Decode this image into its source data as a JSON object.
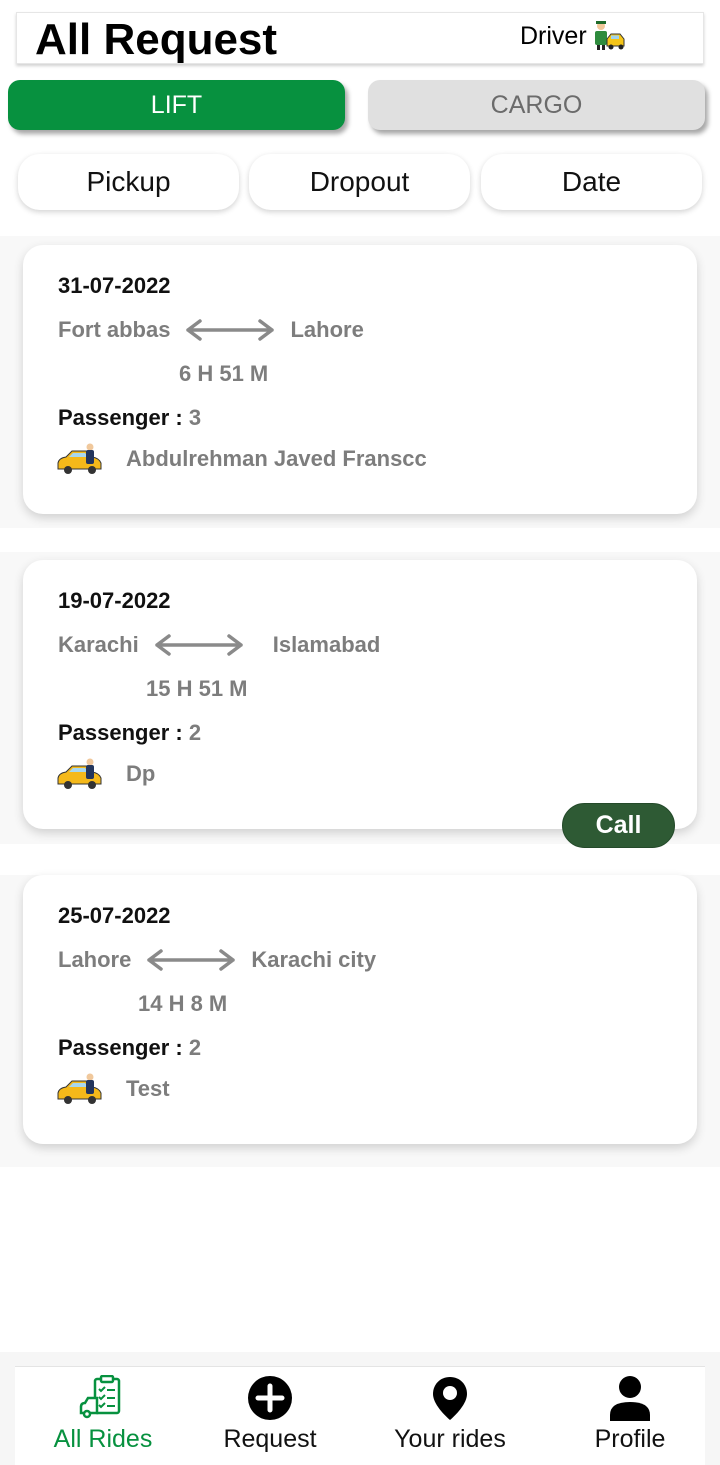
{
  "header": {
    "title": "All Request",
    "role": "Driver",
    "role_icon": "driver-taxi-icon"
  },
  "tabs": [
    {
      "label": "LIFT",
      "active": true
    },
    {
      "label": "CARGO",
      "active": false
    }
  ],
  "filters": [
    {
      "label": "Pickup"
    },
    {
      "label": "Dropout"
    },
    {
      "label": "Date"
    }
  ],
  "requests": [
    {
      "date": "31-07-2022",
      "from": "Fort abbas",
      "to": "Lahore",
      "duration": "6 H 51 M",
      "passenger_label": "Passenger :",
      "passengers": "3",
      "driver": "Abdulrehman Javed Franscc"
    },
    {
      "date": "19-07-2022",
      "from": "Karachi",
      "to": "Islamabad",
      "duration": "15 H 51 M",
      "passenger_label": "Passenger :",
      "passengers": "2",
      "driver": "Dp",
      "call_label": "Call"
    },
    {
      "date": "25-07-2022",
      "from": "Lahore",
      "to": "Karachi city",
      "duration": "14 H 8 M",
      "passenger_label": "Passenger :",
      "passengers": "2",
      "driver": "Test"
    }
  ],
  "nav": [
    {
      "label": "All Rides",
      "icon": "rides-list-icon",
      "active": true
    },
    {
      "label": "Request",
      "icon": "plus-circle-icon",
      "active": false
    },
    {
      "label": "Your rides",
      "icon": "map-pin-icon",
      "active": false
    },
    {
      "label": "Profile",
      "icon": "person-icon",
      "active": false
    }
  ],
  "colors": {
    "primary": "#07913f",
    "call": "#2e5a34",
    "muted_text": "#7d7d7d"
  }
}
